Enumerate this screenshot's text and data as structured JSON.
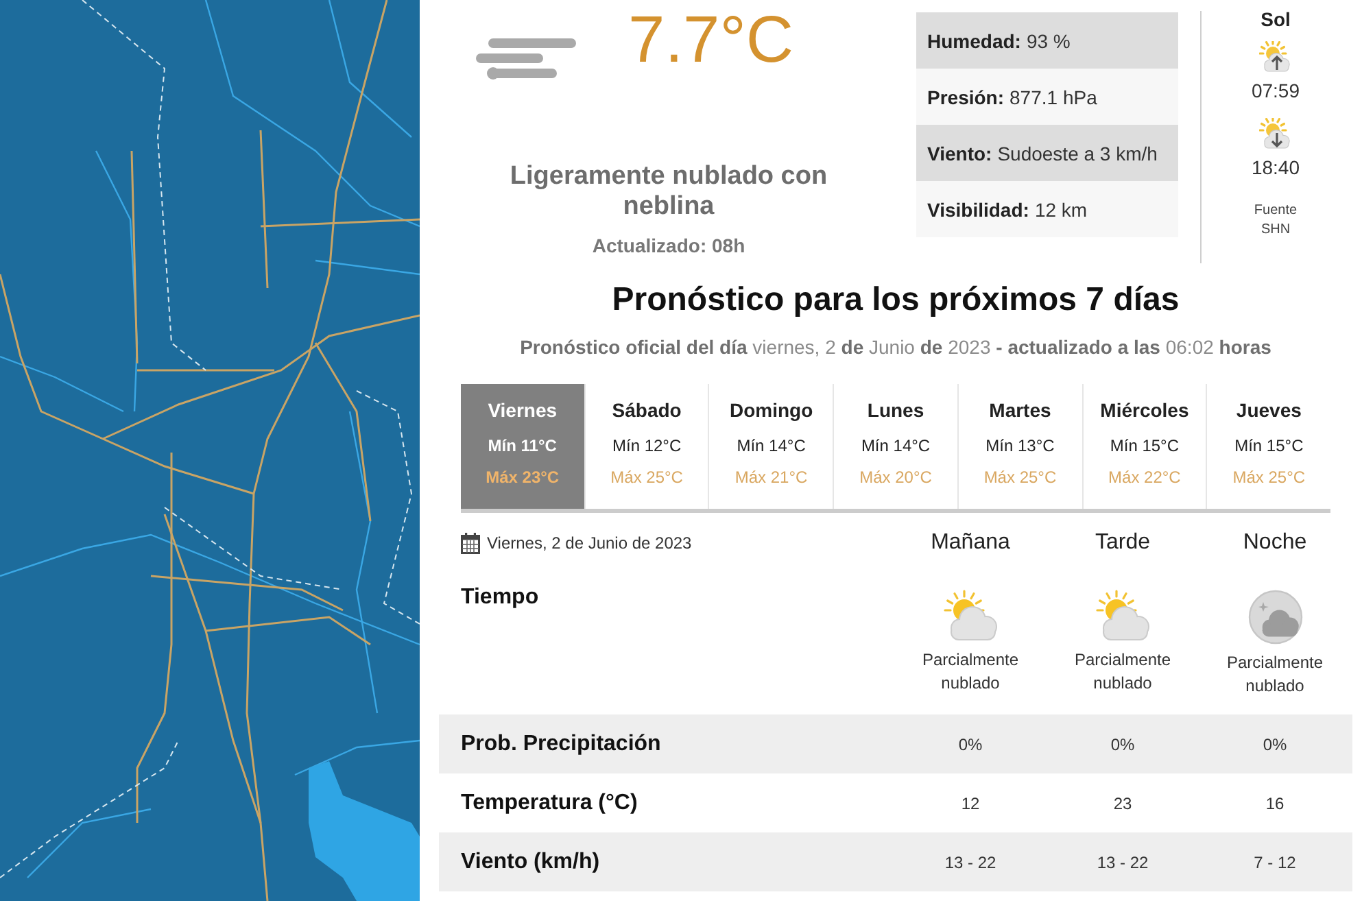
{
  "current": {
    "temperature": "7.7°C",
    "condition": "Ligeramente nublado con neblina",
    "updated": "Actualizado: 08h"
  },
  "details": [
    {
      "label": "Humedad:",
      "value": "93 %"
    },
    {
      "label": "Presión:",
      "value": "877.1 hPa"
    },
    {
      "label": "Viento:",
      "value": "Sudoeste a 3 km/h"
    },
    {
      "label": "Visibilidad:",
      "value": "12 km"
    }
  ],
  "sun": {
    "title": "Sol",
    "sunrise": "07:59",
    "sunset": "18:40",
    "source": "Fuente SHN"
  },
  "forecast": {
    "title": "Pronóstico para los próximos 7 días",
    "subtitle": "**Pronóstico oficial del día** viernes, 2 **de** Junio **de** 2023 **- actualizado a las** 06:02 **horas**",
    "days": [
      {
        "name": "Viernes",
        "min": "Mín 11°C",
        "max": "Máx 23°C",
        "selected": true
      },
      {
        "name": "Sábado",
        "min": "Mín 12°C",
        "max": "Máx 25°C",
        "selected": false
      },
      {
        "name": "Domingo",
        "min": "Mín 14°C",
        "max": "Máx 21°C",
        "selected": false
      },
      {
        "name": "Lunes",
        "min": "Mín 14°C",
        "max": "Máx 20°C",
        "selected": false
      },
      {
        "name": "Martes",
        "min": "Mín 13°C",
        "max": "Máx 25°C",
        "selected": false
      },
      {
        "name": "Miércoles",
        "min": "Mín 15°C",
        "max": "Máx 22°C",
        "selected": false
      },
      {
        "name": "Jueves",
        "min": "Mín 15°C",
        "max": "Máx 25°C",
        "selected": false
      }
    ]
  },
  "detail": {
    "date": "Viernes, 2 de Junio de 2023",
    "weather_label": "Tiempo",
    "periods": [
      {
        "name": "Mañana",
        "kind": "day",
        "condition": "Parcialmente nublado"
      },
      {
        "name": "Tarde",
        "kind": "day",
        "condition": "Parcialmente nublado"
      },
      {
        "name": "Noche",
        "kind": "night",
        "condition": "Parcialmente nublado"
      }
    ],
    "rows": [
      {
        "label": "Prob. Precipitación",
        "values": [
          "0%",
          "0%",
          "0%"
        ]
      },
      {
        "label": "Temperatura (°C)",
        "values": [
          "12",
          "23",
          "16"
        ]
      },
      {
        "label": "Viento (km/h)",
        "values": [
          "13 - 22",
          "13 - 22",
          "7 - 12"
        ]
      }
    ]
  }
}
